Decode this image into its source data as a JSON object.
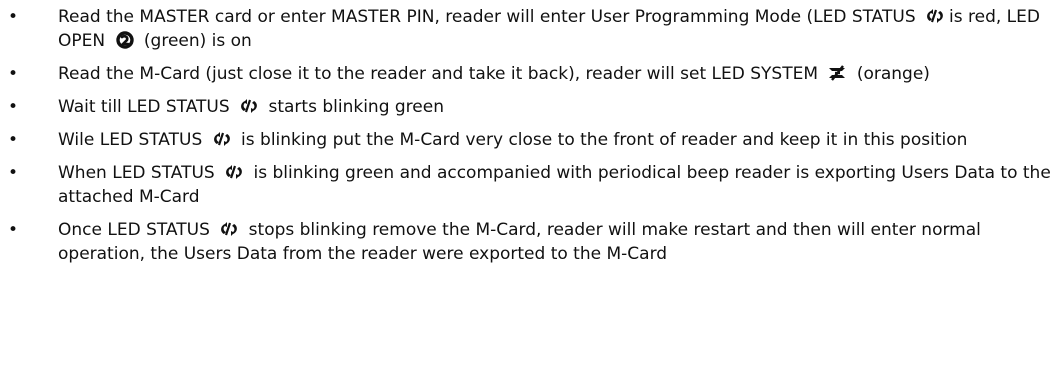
{
  "steps": [
    {
      "t1": "Read the MASTER card or enter MASTER PIN, reader will enter User Programming Mode (LED STATUS ",
      "i1": "led-status-icon",
      "t2": "is red, LED OPEN ",
      "i2": "led-open-icon",
      "t3": " (green) is on"
    },
    {
      "t1": "Read the M-Card (just close it to the reader and take it back), reader will set LED SYSTEM ",
      "i1": "led-system-icon",
      "t2": " (orange)"
    },
    {
      "t1": "Wait till LED STATUS ",
      "i1": "led-status-icon",
      "t2": " starts blinking green"
    },
    {
      "t1": "Wile LED STATUS ",
      "i1": "led-status-icon",
      "t2": " is blinking put the M-Card very close to the front of reader and keep it in this position"
    },
    {
      "t1": "When LED STATUS ",
      "i1": "led-status-icon",
      "t2": " is blinking green and accompanied with periodical beep reader is exporting Users Data to the attached M-Card"
    },
    {
      "t1": "Once LED STATUS ",
      "i1": "led-status-icon",
      "t2": " stops blinking remove the M-Card, reader will make restart and then will enter normal operation, the Users Data from the reader were exported to the M-Card"
    }
  ]
}
